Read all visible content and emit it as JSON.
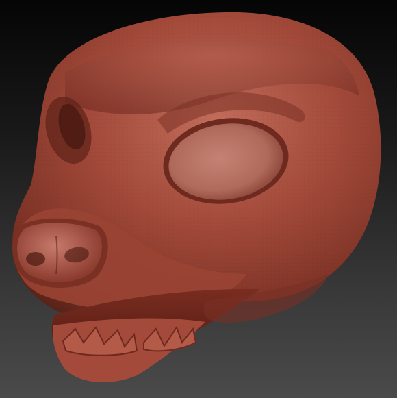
{
  "scene": {
    "subject": "sculpted-animal-head",
    "material_colors": {
      "base": "#a34a3a",
      "highlight": "#c87363",
      "shadow": "#5e2218",
      "deep_shadow": "#3a130d"
    },
    "background_colors": {
      "top": "#050505",
      "bottom": "#4a4a4a"
    }
  }
}
